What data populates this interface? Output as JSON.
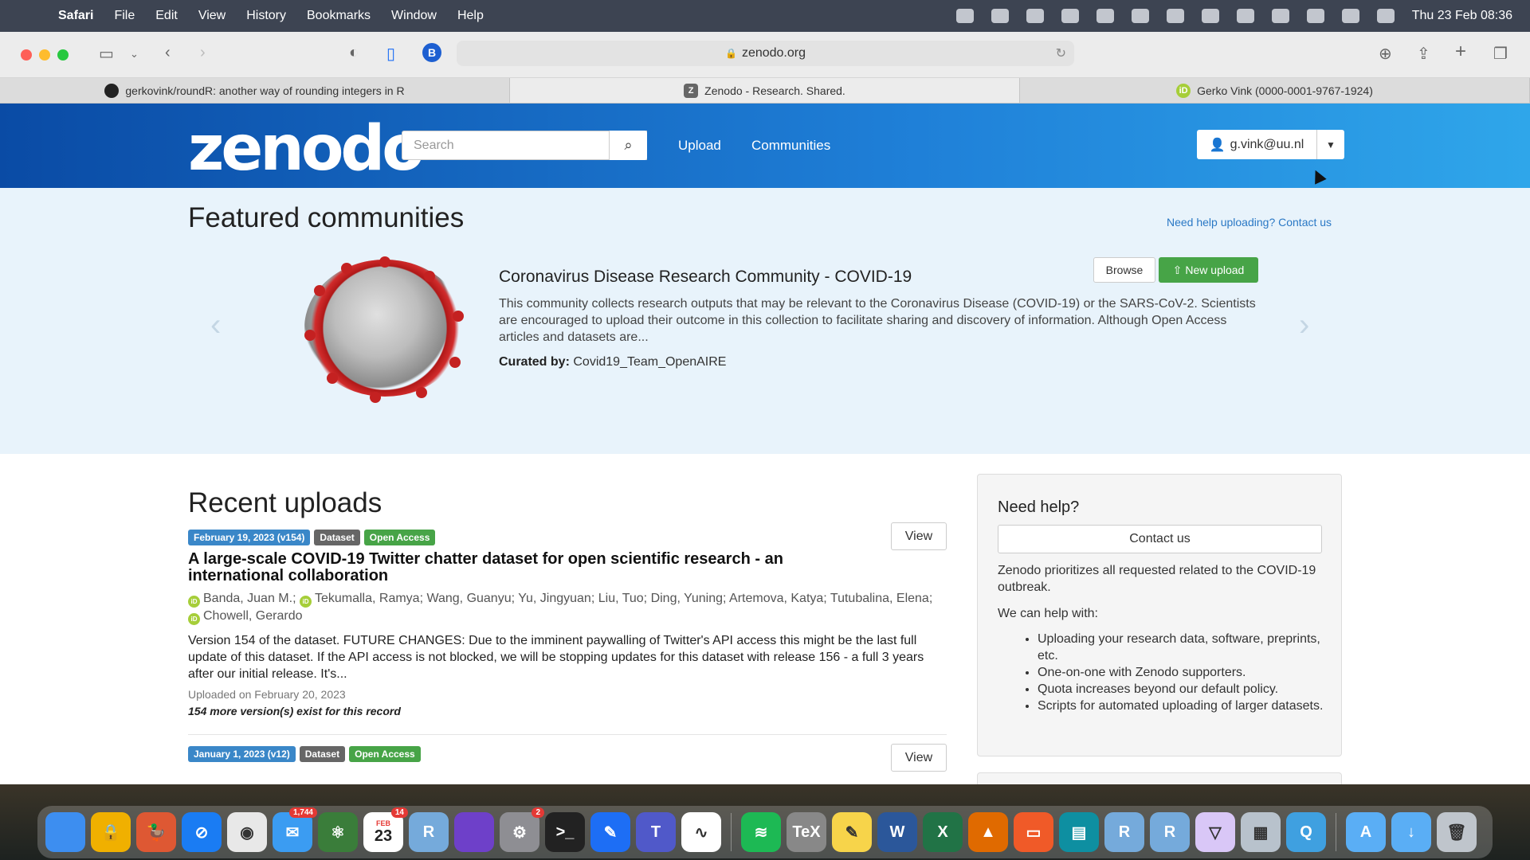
{
  "menubar": {
    "items": [
      "Safari",
      "File",
      "Edit",
      "View",
      "History",
      "Bookmarks",
      "Window",
      "Help"
    ],
    "clock": "Thu 23 Feb  08:36"
  },
  "browser": {
    "url": "zenodo.org",
    "tabs": [
      {
        "label": "gerkovink/roundR: another way of rounding integers in R",
        "icon": "github-icon"
      },
      {
        "label": "Zenodo - Research. Shared.",
        "icon": "zenodo-icon"
      },
      {
        "label": "Gerko Vink (0000-0001-9767-1924)",
        "icon": "orcid-icon"
      }
    ]
  },
  "header": {
    "logo": "zenodo",
    "search_placeholder": "Search",
    "nav": [
      "Upload",
      "Communities"
    ],
    "user": "g.vink@uu.nl"
  },
  "featured": {
    "title": "Featured communities",
    "help_link": "Need help uploading? Contact us",
    "community": {
      "name": "Coronavirus Disease Research Community - COVID-19",
      "description": "This community collects research outputs that may be relevant to the Coronavirus Disease (COVID-19) or the SARS-CoV-2. Scientists are encouraged to upload their outcome in this collection to facilitate sharing and discovery of information. Although Open Access articles and datasets are...",
      "curated_label": "Curated by:",
      "curated_by": "Covid19_Team_OpenAIRE",
      "browse": "Browse",
      "new_upload": "New upload"
    }
  },
  "recent": {
    "title": "Recent uploads",
    "records": [
      {
        "date": "February 19, 2023 (v154)",
        "type": "Dataset",
        "access": "Open Access",
        "view": "View",
        "title": "A large-scale COVID-19 Twitter chatter dataset for open scientific research - an international collaboration",
        "authors": [
          {
            "name": "Banda, Juan M.;",
            "orcid": true
          },
          {
            "name": "Tekumalla, Ramya;",
            "orcid": true
          },
          {
            "name": "Wang, Guanyu;",
            "orcid": false
          },
          {
            "name": "Yu, Jingyuan;",
            "orcid": false
          },
          {
            "name": "Liu, Tuo;",
            "orcid": false
          },
          {
            "name": "Ding, Yuning;",
            "orcid": false
          },
          {
            "name": "Artemova, Katya;",
            "orcid": false
          },
          {
            "name": "Tutubalina, Elena;",
            "orcid": false
          },
          {
            "name": "Chowell, Gerardo",
            "orcid": true
          }
        ],
        "description": "Version 154 of the dataset. FUTURE CHANGES: Due to the imminent paywalling of Twitter's API access this might be the last full update of this dataset. If the API access is not blocked, we will be stopping updates for this dataset with release 156 - a full 3 years after our initial release. It's...",
        "uploaded": "Uploaded on February 20, 2023",
        "versions": "154 more version(s) exist for this record"
      },
      {
        "date": "January 1, 2023 (v12)",
        "type": "Dataset",
        "access": "Open Access",
        "view": "View"
      }
    ]
  },
  "help": {
    "title": "Need help?",
    "contact": "Contact us",
    "p1": "Zenodo prioritizes all requested related to the COVID-19 outbreak.",
    "p2": "We can help with:",
    "items": [
      "Uploading your research data, software, preprints, etc.",
      "One-on-one with Zenodo supporters.",
      "Quota increases beyond our default policy.",
      "Scripts for automated uploading of larger datasets."
    ]
  },
  "dock": {
    "calendar_month": "FEB",
    "calendar_day": "23",
    "mail_badge": "1,744",
    "calendar_badge": "14",
    "settings_badge": "2",
    "apps": [
      {
        "name": "finder",
        "color": "#3d8ef0",
        "glyph": ""
      },
      {
        "name": "lock",
        "color": "#f0b000",
        "glyph": "🔒"
      },
      {
        "name": "duckduckgo",
        "color": "#de5833",
        "glyph": "🦆"
      },
      {
        "name": "safari",
        "color": "#1a7cf3",
        "glyph": "⊘"
      },
      {
        "name": "chrome",
        "color": "#e8e8e8",
        "glyph": "◉"
      },
      {
        "name": "mail",
        "color": "#3b9cf2",
        "glyph": "✉"
      },
      {
        "name": "atom",
        "color": "#3a7d3a",
        "glyph": "⚛"
      },
      {
        "name": "calendar",
        "color": "#ffffff",
        "glyph": ""
      },
      {
        "name": "rstudio",
        "color": "#75aadb",
        "glyph": "R"
      },
      {
        "name": "github-desktop",
        "color": "#6e40c9",
        "glyph": ""
      },
      {
        "name": "system-settings",
        "color": "#8e8e93",
        "glyph": "⚙"
      },
      {
        "name": "terminal",
        "color": "#222222",
        "glyph": ">_"
      },
      {
        "name": "xcode-pencil",
        "color": "#1d6ef5",
        "glyph": "✎"
      },
      {
        "name": "teams",
        "color": "#5059c9",
        "glyph": "T"
      },
      {
        "name": "freeform",
        "color": "#ffffff",
        "glyph": "∿"
      },
      {
        "name": "spotify",
        "color": "#1db954",
        "glyph": "≋"
      },
      {
        "name": "tex",
        "color": "#888888",
        "glyph": "TeX"
      },
      {
        "name": "notes",
        "color": "#f7d44a",
        "glyph": "✎"
      },
      {
        "name": "word",
        "color": "#2b579a",
        "glyph": "W"
      },
      {
        "name": "excel",
        "color": "#217346",
        "glyph": "X"
      },
      {
        "name": "vlc",
        "color": "#e06a00",
        "glyph": "▲"
      },
      {
        "name": "toolbox",
        "color": "#f05a28",
        "glyph": "▭"
      },
      {
        "name": "claquette",
        "color": "#0e8fa1",
        "glyph": "▤"
      },
      {
        "name": "r-app",
        "color": "#75aadb",
        "glyph": "R"
      },
      {
        "name": "r-gui",
        "color": "#75aadb",
        "glyph": "R"
      },
      {
        "name": "vpn",
        "color": "#d9c7f7",
        "glyph": "▽"
      },
      {
        "name": "preview",
        "color": "#b8c2cc",
        "glyph": "▦"
      },
      {
        "name": "quicktime",
        "color": "#3fa0e0",
        "glyph": "Q"
      },
      {
        "name": "applications-folder",
        "color": "#5aaef5",
        "glyph": "A"
      },
      {
        "name": "downloads-folder",
        "color": "#5aaef5",
        "glyph": "↓"
      },
      {
        "name": "trash",
        "color": "#bfc5cc",
        "glyph": "🗑"
      }
    ]
  }
}
